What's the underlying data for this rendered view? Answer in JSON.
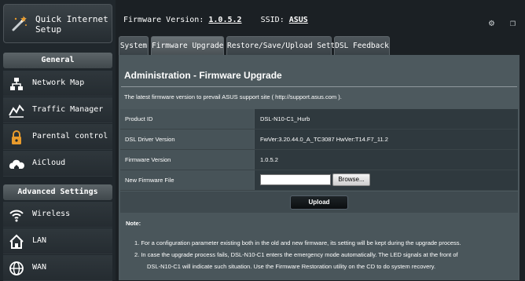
{
  "sidebar": {
    "qis_label": "Quick Internet Setup",
    "general_header": "General",
    "general_items": [
      "Network Map",
      "Traffic Manager",
      "Parental control",
      "AiCloud"
    ],
    "advanced_header": "Advanced Settings",
    "advanced_items": [
      "Wireless",
      "LAN",
      "WAN"
    ]
  },
  "topbar": {
    "firmware_label": "Firmware Version:",
    "firmware_value": "1.0.5.2",
    "ssid_label": "SSID:",
    "ssid_value": "ASUS"
  },
  "tabs": [
    "System",
    "Firmware Upgrade",
    "Restore/Save/Upload Setting",
    "DSL Feedback"
  ],
  "panel": {
    "title": "Administration - Firmware Upgrade",
    "description": "The latest firmware version to prevail ASUS support site ( http://support.asus.com ).",
    "rows": [
      {
        "label": "Product ID",
        "value": "DSL-N10-C1_Hurb"
      },
      {
        "label": "DSL Driver Version",
        "value": "FwVer:3.20.44.0_A_TC3087 HwVer:T14.F7_11.2"
      },
      {
        "label": "Firmware Version",
        "value": "1.0.5.2"
      },
      {
        "label": "New Firmware File",
        "value": ""
      }
    ],
    "browse_label": "Browse...",
    "upload_label": "Upload",
    "note_label": "Note:",
    "notes": [
      "1.   For a configuration parameter existing both in the old and new firmware, its setting will be kept during the upgrade process.",
      "2.   In case the upgrade process fails, DSL-N10-C1 enters the emergency mode automatically. The LED signals at the front of",
      "DSL-N10-C1 will indicate such situation. Use the Firmware Restoration utility on the CD to do system recovery."
    ]
  },
  "colors": {
    "accent": "#e89b2c",
    "panel_bg": "#4d595e"
  }
}
